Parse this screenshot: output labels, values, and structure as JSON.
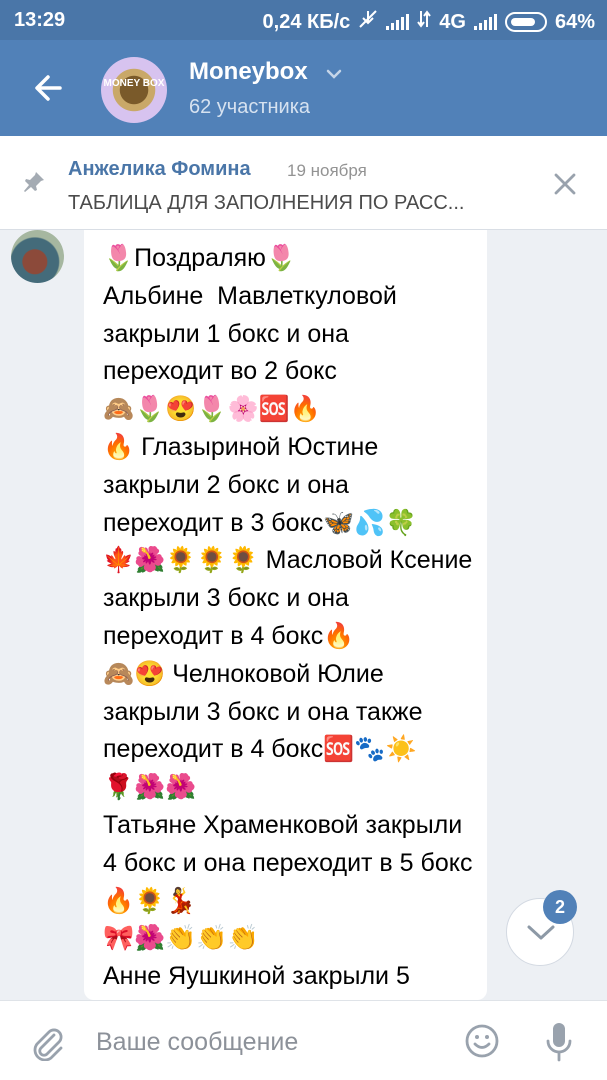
{
  "statusbar": {
    "time": "13:29",
    "speed": "0,24 КБ/с",
    "network": "4G",
    "battery": "64%"
  },
  "header": {
    "title": "Moneybox",
    "members": "62 участника",
    "avatar_text": "MONEY BOX"
  },
  "pinned": {
    "author": "Анжелика Фомина",
    "date": "19 ноября",
    "text": "ТАБЛИЦА ДЛЯ ЗАПОЛНЕНИЯ ПО РАСС..."
  },
  "message": {
    "text": "🌷Поздраляю🌷\nАльбине  Мавлеткуловой закрыли 1 бокс и она переходит во 2 бокс\n🙈🌷😍🌷🌸🆘🔥\n🔥 Глазыриной Юстине закрыли 2 бокс и она переходит в 3 бокс🦋💦🍀\n🍁🌺🌻🌻🌻 Масловой Ксение закрыли 3 бокс и она переходит в 4 бокс🔥\n🙈😍 Челноковой Юлие закрыли 3 бокс и она также переходит в 4 бокс🆘🐾☀️\n🌹🌺🌺\nТатьяне Храменковой закрыли 4 бокс и она переходит в 5 бокс🔥🌻💃\n🎀🌺👏👏👏\nАнне Яушкиной закрыли 5"
  },
  "scroll": {
    "unread_count": "2"
  },
  "composer": {
    "placeholder": "Ваше сообщение"
  }
}
